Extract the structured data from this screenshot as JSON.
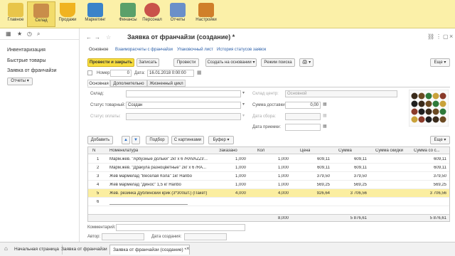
{
  "sections": [
    {
      "label": "Главное",
      "color": "#e8c54a"
    },
    {
      "label": "Склад",
      "color": "#c98d4a"
    },
    {
      "label": "Продажи",
      "color": "#f0b320"
    },
    {
      "label": "Маркетинг",
      "color": "#3b83c9"
    },
    {
      "label": "Финансы",
      "color": "#5aa06a"
    },
    {
      "label": "Персонал",
      "color": "#c9524a"
    },
    {
      "label": "Отчеты",
      "color": "#6a8fc9"
    },
    {
      "label": "Настройки",
      "color": "#d07f2a"
    }
  ],
  "left_panel": {
    "links": [
      "Инвентаризация",
      "Быстрые товары",
      "Заявка от франчайзи"
    ],
    "reports_button": "Отчеты ▾"
  },
  "document": {
    "title": "Заявка от франчайзи (создание) *",
    "top_links": [
      "Основное",
      "Взаиморасчеты с франчайзи",
      "Упаковочный лист",
      "История статусов заявок"
    ],
    "toolbar": {
      "post_close": "Провести и закрыть",
      "save": "Записать",
      "post": "Провести",
      "create_based": "Создать на основании ▾",
      "search_mode": "Режим поиска",
      "print": "🖨 ▾",
      "more": "Еще ▾"
    },
    "number_label": "Номер:",
    "number_value": "0",
    "date_label": "Дата:",
    "date_value": "16.01.2018  0:00:00",
    "tabs": [
      "Основная",
      "Дополнительно",
      "Жизненный цикл"
    ],
    "fields": {
      "warehouse_label": "Склад:",
      "warehouse_value": "",
      "wh_center_label": "Склад центр:",
      "wh_center_value": "Основной",
      "goods_status_label": "Статус товарный:",
      "goods_status_value": "Создан",
      "delivery_label": "Сумма доставки:",
      "delivery_value": "0,00",
      "payment_status_label": "Статус оплаты:",
      "payment_status_value": "",
      "collect_date_label": "Дата сбора:",
      "collect_date_value": "",
      "receive_date_label": "Дата приемки:",
      "receive_date_value": ""
    },
    "table_toolbar": {
      "add": "Добавить",
      "up": "▲",
      "down": "▼",
      "pick": "Подбор",
      "with_pictures": "С картинками",
      "buffer": "Буфер ▾",
      "more": "Еще ▾"
    },
    "columns": [
      "N",
      "Номенклатура",
      "Заказано",
      "Кол",
      "Цена",
      "Сумма",
      "Сумма скидки",
      "Сумма со с..."
    ],
    "rows": [
      {
        "n": "1",
        "name": "Марм.жев. \"Арбузные дольки\" 2кг х 6 /RAVAZZI/...",
        "ordered": "1,000",
        "qty": "1,000",
        "price": "609,11",
        "sum": "609,11",
        "discount": "",
        "total": "609,11"
      },
      {
        "n": "2",
        "name": "Марм.жев. \"Дракула разноцветные\" 2кг х 6 /RA...",
        "ordered": "1,000",
        "qty": "1,000",
        "price": "609,11",
        "sum": "609,11",
        "discount": "",
        "total": "609,11"
      },
      {
        "n": "3",
        "name": "Жев мармелад \"Веселая Кола\" 1кг Haribo",
        "ordered": "1,000",
        "qty": "1,000",
        "price": "379,50",
        "sum": "379,50",
        "discount": "",
        "total": "379,50"
      },
      {
        "n": "4",
        "name": "Жев мармелад \"Динос\" 1,5 кг Haribo",
        "ordered": "1,000",
        "qty": "1,000",
        "price": "569,25",
        "sum": "569,25",
        "discount": "",
        "total": "569,25"
      },
      {
        "n": "5",
        "name": "Жев. резинка Дублинский крик (3*300шт.) (Пакет)",
        "ordered": "4,000",
        "qty": "4,000",
        "price": "926,64",
        "sum": "3 706,56",
        "discount": "",
        "total": "3 706,56"
      },
      {
        "n": "6",
        "name": "",
        "ordered": "",
        "qty": "",
        "price": "",
        "sum": "",
        "discount": "",
        "total": ""
      }
    ],
    "totals": {
      "qty": "8,000",
      "sum": "5 876,61",
      "total": "5 876,61"
    },
    "comment_label": "Комментарий:",
    "comment_value": "",
    "author_label": "Автор:",
    "author_value": "",
    "created_label": "Дата создания:",
    "created_value": ""
  },
  "taskbar": [
    "Начальная страница",
    "Заявка от франчайзи",
    "Заявка от франчайзи (создание) *"
  ]
}
